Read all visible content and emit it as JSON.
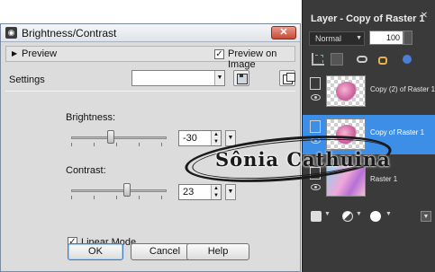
{
  "dialog": {
    "title": "Brightness/Contrast",
    "close_label": "✕",
    "preview_label": "Preview",
    "preview_on_image_label": "Preview on Image",
    "preview_on_image_checked": true,
    "settings_label": "Settings",
    "settings_value": "",
    "brightness": {
      "label": "Brightness:",
      "value": "-30"
    },
    "contrast": {
      "label": "Contrast:",
      "value": "23"
    },
    "linear_mode_label": "Linear Mode",
    "linear_mode_checked": true,
    "buttons": {
      "ok": "OK",
      "cancel": "Cancel",
      "help": "Help"
    }
  },
  "layers_panel": {
    "title": "Layer - Copy of Raster 1",
    "blend_mode": "Normal",
    "opacity": "100",
    "layers": [
      {
        "name": "Copy (2) of Raster 1",
        "selected": false
      },
      {
        "name": "Copy of Raster 1",
        "selected": true
      },
      {
        "name": "Raster 1",
        "selected": false
      }
    ]
  },
  "watermark": {
    "text": "Sônia Cathuina"
  },
  "icons": [
    "app-icon",
    "close-icon",
    "expand-arrow-icon",
    "save-preset-icon",
    "manage-presets-icon",
    "layer-visibility-icon",
    "eye-icon",
    "new-layer-icon",
    "link-icon",
    "lock-icon",
    "mask-icon"
  ]
}
